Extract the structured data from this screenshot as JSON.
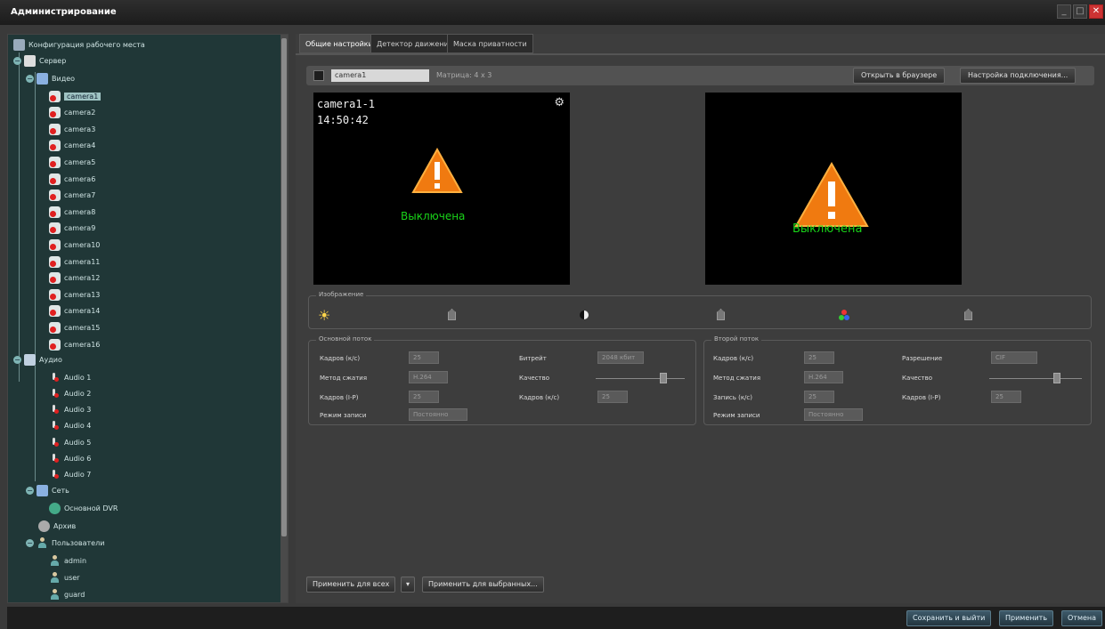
{
  "window": {
    "title": "Администрирование",
    "controls": [
      "_",
      "□",
      "✕"
    ]
  },
  "tree": {
    "root_label": "Конфигурация рабочего места",
    "server_label": "Сервер",
    "video_group_label": "Видео",
    "cameras": [
      "camera1",
      "camera2",
      "camera3",
      "camera4",
      "camera5",
      "camera6",
      "camera7",
      "camera8",
      "camera9",
      "camera10",
      "camera11",
      "camera12",
      "camera13",
      "camera14",
      "camera15",
      "camera16"
    ],
    "selected_camera": "camera1",
    "audio_group_label": "Аудио",
    "audio_items": [
      "Audio 1",
      "Audio 2",
      "Audio 3",
      "Audio 4",
      "Audio 5",
      "Audio 6",
      "Audio 7"
    ],
    "network_group_label": "Сеть",
    "network_item": "Основной DVR",
    "system_label": "Архив",
    "users_group_label": "Пользователи",
    "users": [
      "admin",
      "user",
      "guard"
    ]
  },
  "tabs": [
    {
      "label": "Общие настройки",
      "active": true
    },
    {
      "label": "Детектор движения",
      "active": false
    },
    {
      "label": "Маска приватности",
      "active": false
    }
  ],
  "camera_bar": {
    "name_value": "camera1",
    "meta": "Матрица: 4 x 3",
    "open_browser_button": "Открыть в браузере",
    "connection_settings_button": "Настройка подключения..."
  },
  "preview_left": {
    "osd_name": "camera1-1",
    "osd_time": "14:50:42",
    "status": "Выключена"
  },
  "preview_right": {
    "status": "Выключена"
  },
  "image_group": {
    "title": "Изображение"
  },
  "main_stream": {
    "title": "Основной поток",
    "fields": [
      {
        "label": "Кадров (к/с)",
        "value": "25"
      },
      {
        "label": "Битрейт",
        "value": "2048 кбит"
      },
      {
        "label": "Метод сжатия",
        "value": "H.264"
      },
      {
        "label": "Качество",
        "value": ""
      },
      {
        "label": "Кадров (I-P)",
        "value": "25"
      },
      {
        "label": "Кадров (к/с)",
        "value": "25"
      },
      {
        "label": "Режим записи",
        "value": "Постоянно"
      }
    ]
  },
  "sub_stream": {
    "title": "Второй поток",
    "fields": [
      {
        "label": "Кадров (к/с)",
        "value": "25"
      },
      {
        "label": "Разрешение",
        "value": "CIF"
      },
      {
        "label": "Метод сжатия",
        "value": "H.264"
      },
      {
        "label": "Качество",
        "value": ""
      },
      {
        "label": "Запись (к/с)",
        "value": "25"
      },
      {
        "label": "Кадров (I-P)",
        "value": "25"
      },
      {
        "label": "Режим записи",
        "value": "Постоянно"
      }
    ]
  },
  "bottom_actions": {
    "apply_all": "Применить для всех",
    "apply_selected": "Применить для выбранных..."
  },
  "status_bar": {
    "save_exit": "Сохранить и выйти",
    "apply": "Применить",
    "cancel": "Отмена"
  },
  "colors": {
    "accent_green": "#19d419",
    "tree_bg": "#203737",
    "warning_orange": "#f07a10"
  }
}
